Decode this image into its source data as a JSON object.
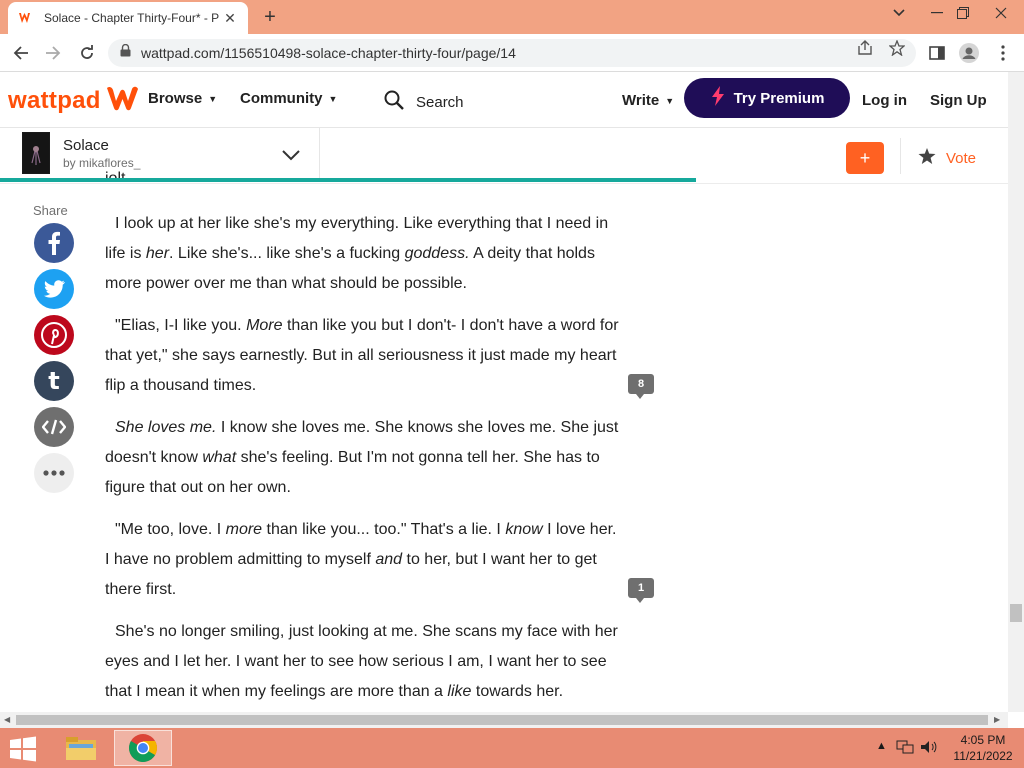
{
  "browser": {
    "tab_title": "Solace - Chapter Thirty-Four* - P",
    "url": "wattpad.com/1156510498-solace-chapter-thirty-four/page/14"
  },
  "header": {
    "logo": "wattpad",
    "nav": {
      "browse": "Browse",
      "community": "Community",
      "search": "Search",
      "write": "Write"
    },
    "premium": "Try Premium",
    "login": "Log in",
    "signup": "Sign Up"
  },
  "story": {
    "title": "Solace",
    "author": "by mikaflores_",
    "add": "+",
    "vote": "Vote",
    "progress": 0.69
  },
  "share": {
    "label": "Share",
    "buttons": [
      {
        "name": "facebook",
        "color": "#3b5998"
      },
      {
        "name": "twitter",
        "color": "#1da1f2"
      },
      {
        "name": "pinterest",
        "color": "#bd081c"
      },
      {
        "name": "tumblr",
        "color": "#35465c"
      },
      {
        "name": "embed",
        "color": "#6f6f6f"
      },
      {
        "name": "more",
        "color": "#eeeeee"
      }
    ]
  },
  "content": {
    "cut_text": "jolt.",
    "comment_counts": {
      "p2": "8",
      "p4": "1"
    },
    "p1": {
      "a": "I look up at her like she's my everything. Like everything that I need in life is ",
      "b": "her",
      "c": ". Like she's... like she's a fucking ",
      "d": "goddess.",
      "e": " A deity that holds more power over me than what should be possible."
    },
    "p2": {
      "a": "\"Elias, I-I like you. ",
      "b": "More",
      "c": " than like you but I don't- I don't have a word for that yet,\" she says earnestly. But in all seriousness it just made my heart flip a thousand times."
    },
    "p3": {
      "a": "She loves me.",
      "b": " I know she loves me. She knows she loves me. She just doesn't know ",
      "c": "what",
      "d": " she's feeling. But I'm not gonna tell her. She has to figure that out on her own."
    },
    "p4": {
      "a": "\"Me too, love. I ",
      "b": "more",
      "c": " than like you... too.\" That's a lie. I ",
      "d": "know",
      "e": " I love her. I have no problem admitting to myself ",
      "f": "and",
      "g": " to her, but I want her to get there first."
    },
    "p5": {
      "a": "She's no longer smiling, just looking at me. She scans my face with her eyes and I let her. I want her to see how serious I am, I want her to see that I mean it when my feelings are more than a ",
      "b": "like",
      "c": " towards her."
    }
  },
  "taskbar": {
    "time": "4:05 PM",
    "date": "11/21/2022"
  },
  "colors": {
    "brand": "#ff500a",
    "premium": "#1f0d57",
    "progress": "#16a99c",
    "vote": "#ff6122"
  }
}
